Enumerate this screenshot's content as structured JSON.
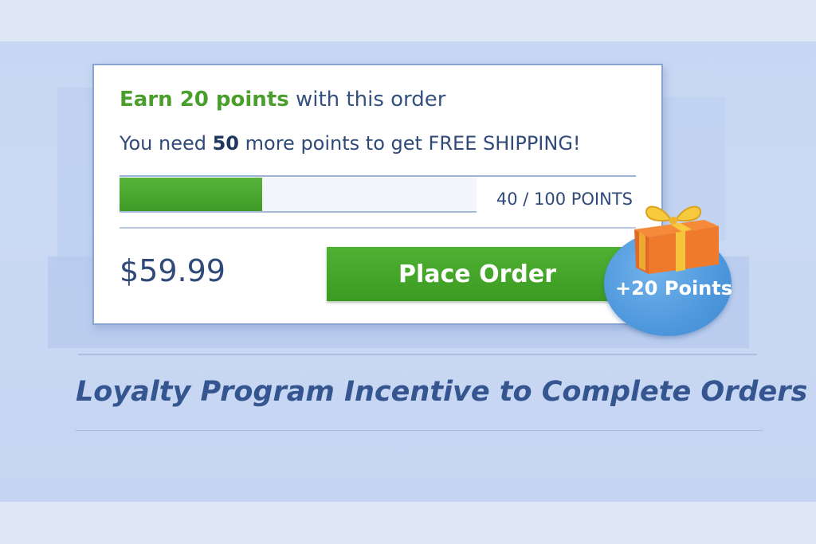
{
  "loyalty_card": {
    "earn_highlight": "Earn 20 points",
    "earn_suffix": " with this order",
    "need_prefix": "You need ",
    "need_amount": "50",
    "need_suffix": " more points to get FREE SHIPPING!",
    "progress": {
      "current": 40,
      "total": 100,
      "label": "40 / 100 POINTS"
    },
    "price": "$59.99",
    "place_order_label": "Place Order"
  },
  "reward_badge": {
    "text": "+20 Points",
    "icon": "gift-icon"
  },
  "caption": "Loyalty Program Incentive to Complete Orders",
  "colors": {
    "accent_green": "#3f9c27",
    "text_navy": "#2f4a78",
    "badge_blue": "#4f98dd",
    "gift_orange": "#f07a2c",
    "ribbon_gold": "#f5c43a",
    "background": "#c9d8f3"
  }
}
